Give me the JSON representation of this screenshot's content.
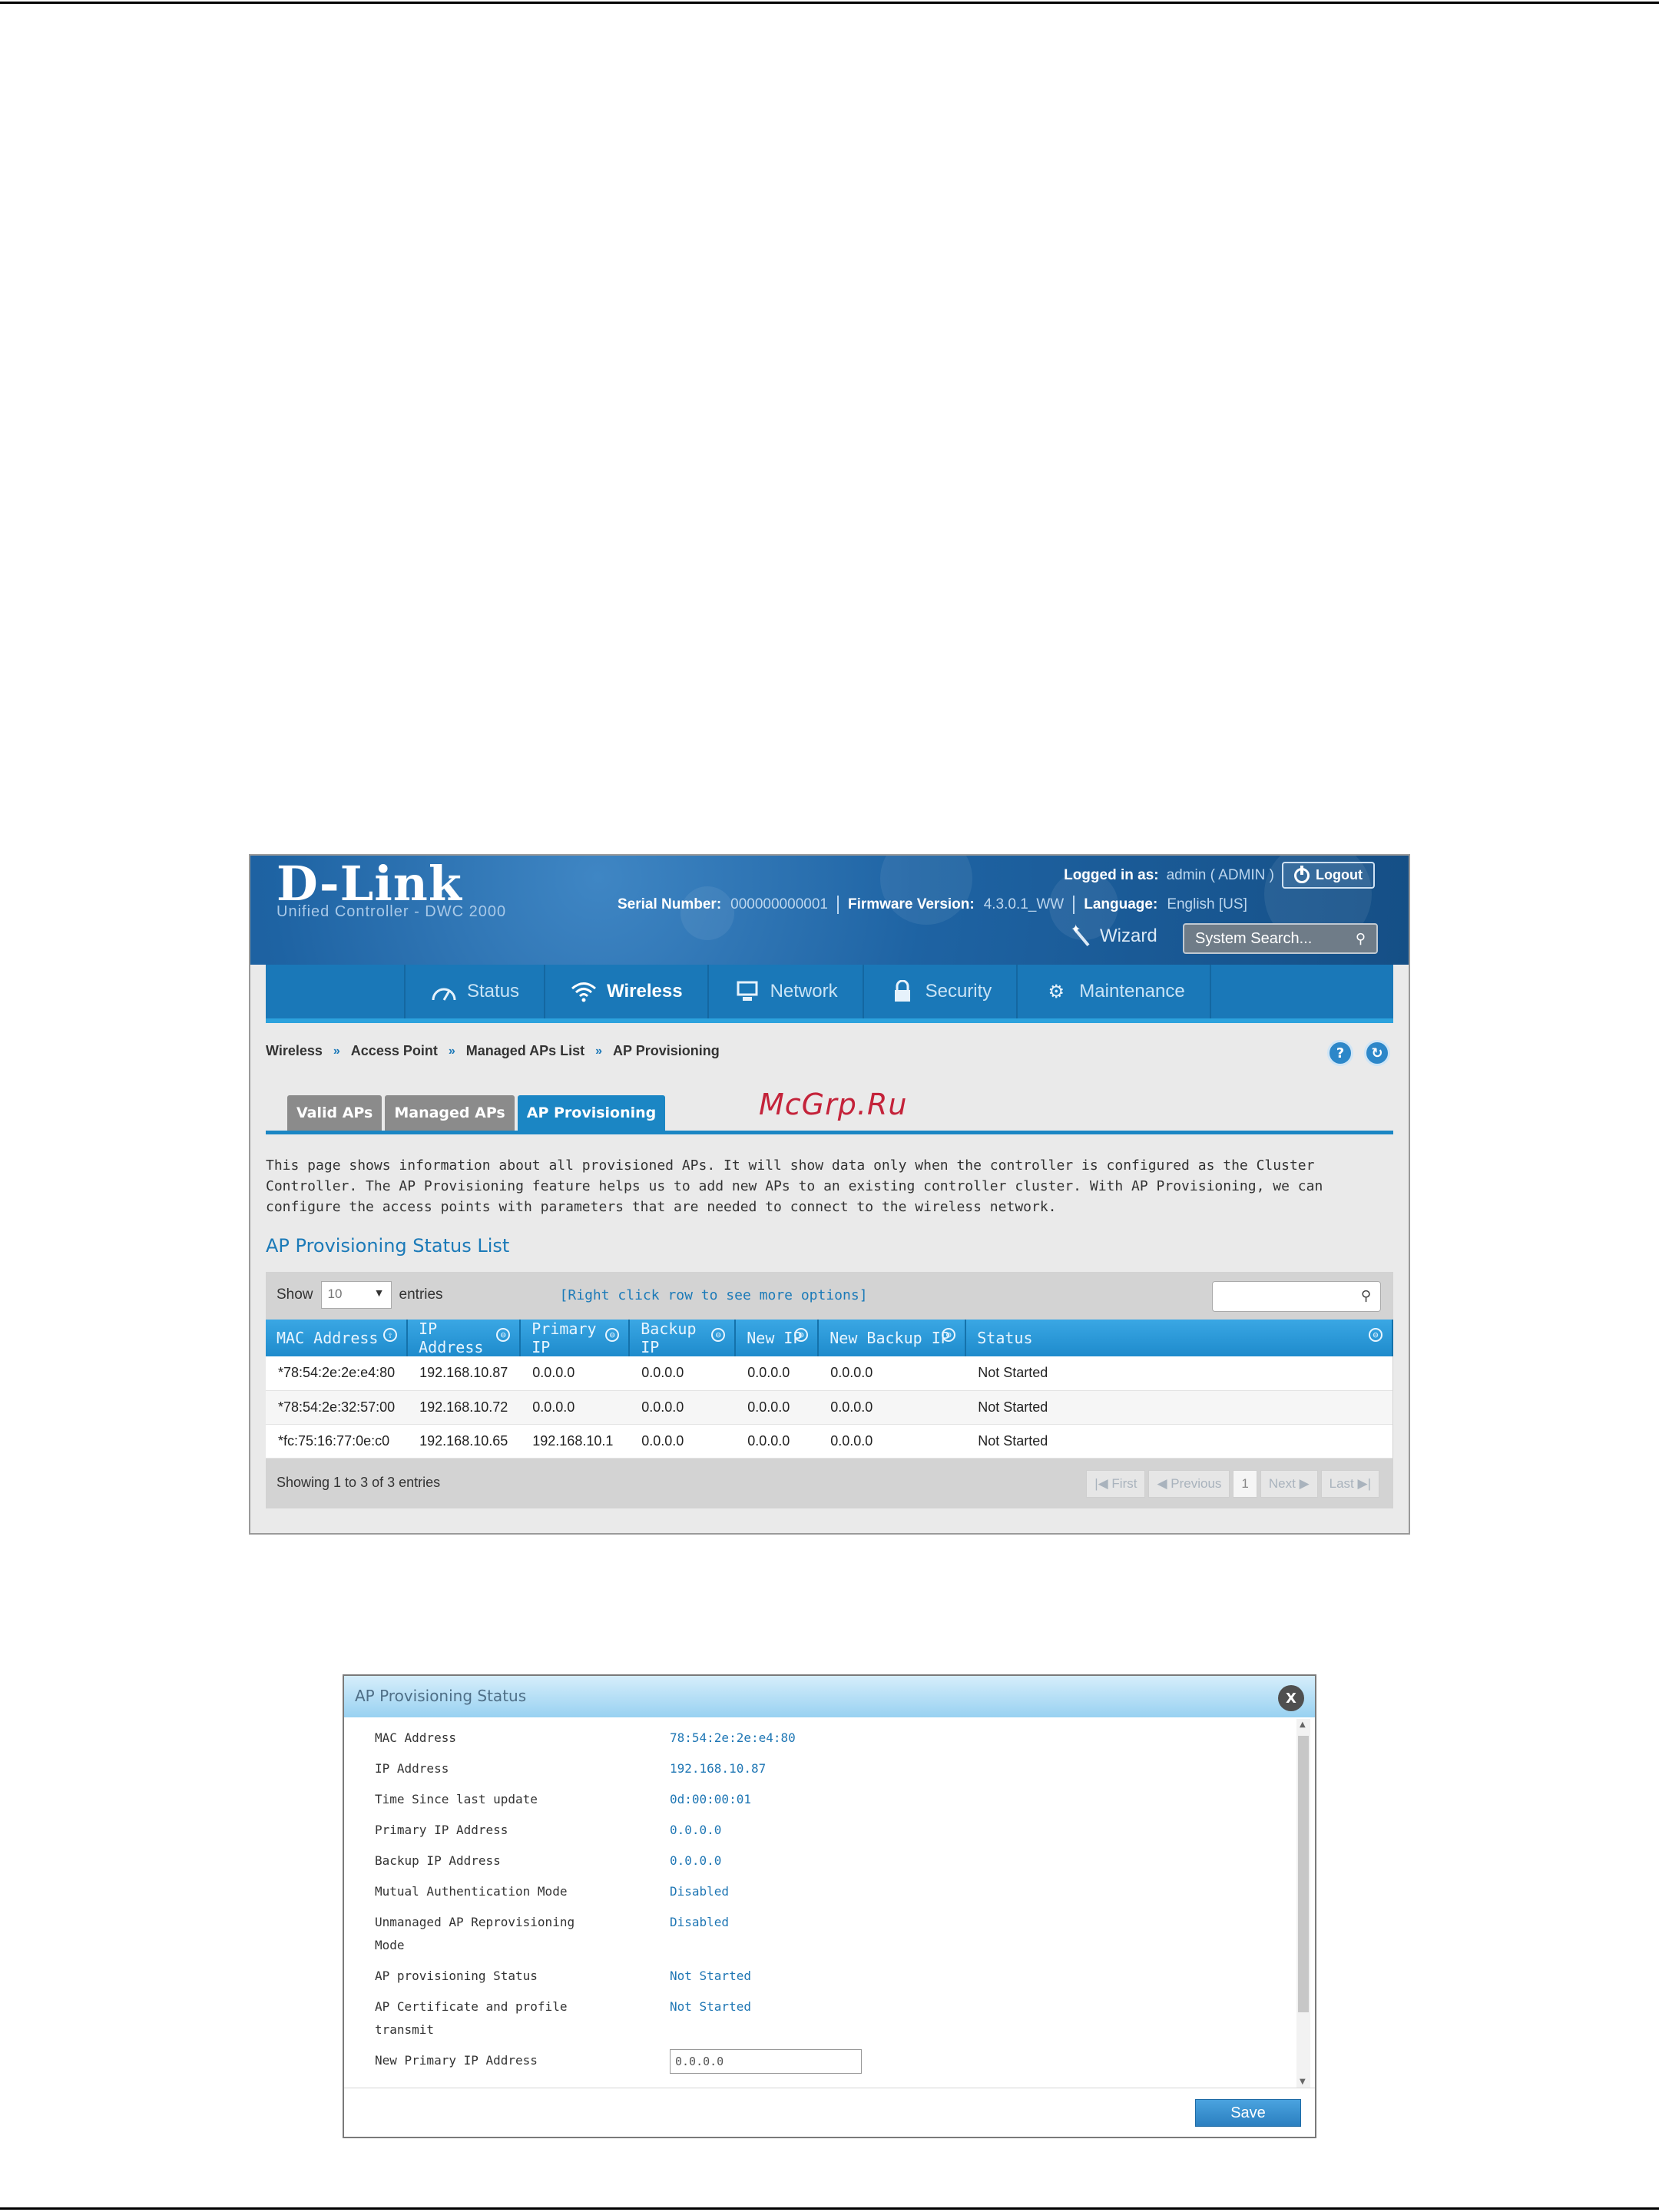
{
  "header": {
    "logo": "D-Link",
    "subtitle": "Unified Controller - DWC 2000",
    "logged_in_label": "Logged in as:",
    "logged_in_value": "admin ( ADMIN )",
    "logout_label": "Logout",
    "serial_label": "Serial Number:",
    "serial_value": "000000000001",
    "firmware_label": "Firmware Version:",
    "firmware_value": "4.3.0.1_WW",
    "language_label": "Language:",
    "language_value": "English [US]",
    "wizard_label": "Wizard",
    "search_placeholder": "System Search..."
  },
  "nav": {
    "items": [
      {
        "label": "Status",
        "icon": "gauge-icon"
      },
      {
        "label": "Wireless",
        "icon": "wifi-icon"
      },
      {
        "label": "Network",
        "icon": "network-icon"
      },
      {
        "label": "Security",
        "icon": "lock-icon"
      },
      {
        "label": "Maintenance",
        "icon": "gears-icon"
      }
    ],
    "active": "Wireless"
  },
  "breadcrumb": [
    "Wireless",
    "Access Point",
    "Managed APs List",
    "AP Provisioning"
  ],
  "tabs": [
    "Valid APs",
    "Managed APs",
    "AP Provisioning"
  ],
  "watermark": "McGrp.Ru",
  "description": "This page shows information about all provisioned APs. It will show data only when the controller is configured as the Cluster Controller. The AP Provisioning feature helps us to add new APs to an existing controller cluster. With AP Provisioning, we can configure the access points with parameters that are needed to connect to the wireless network.",
  "section_title": "AP Provisioning Status List",
  "table": {
    "show_label": "Show",
    "show_value": "10",
    "entries_label": "entries",
    "right_click_hint": "[Right click row to see more options]",
    "columns": [
      "MAC Address",
      "IP Address",
      "Primary IP",
      "Backup IP",
      "New IP",
      "New Backup IP",
      "Status"
    ],
    "rows": [
      [
        "*78:54:2e:2e:e4:80",
        "192.168.10.87",
        "0.0.0.0",
        "0.0.0.0",
        "0.0.0.0",
        "0.0.0.0",
        "Not Started"
      ],
      [
        "*78:54:2e:32:57:00",
        "192.168.10.72",
        "0.0.0.0",
        "0.0.0.0",
        "0.0.0.0",
        "0.0.0.0",
        "Not Started"
      ],
      [
        "*fc:75:16:77:0e:c0",
        "192.168.10.65",
        "192.168.10.1",
        "0.0.0.0",
        "0.0.0.0",
        "0.0.0.0",
        "Not Started"
      ]
    ],
    "footer": "Showing 1 to 3 of 3 entries",
    "pager": {
      "first": "First",
      "previous": "Previous",
      "page": "1",
      "next": "Next",
      "last": "Last"
    }
  },
  "dialog": {
    "title": "AP Provisioning Status",
    "close": "X",
    "fields": [
      {
        "label": "MAC Address",
        "value": "78:54:2e:2e:e4:80"
      },
      {
        "label": "IP Address",
        "value": "192.168.10.87"
      },
      {
        "label": "Time Since last update",
        "value": "0d:00:00:01"
      },
      {
        "label": "Primary IP Address",
        "value": "0.0.0.0"
      },
      {
        "label": "Backup IP Address",
        "value": "0.0.0.0"
      },
      {
        "label": "Mutual Authentication Mode",
        "value": "Disabled"
      },
      {
        "label": "Unmanaged AP Reprovisioning Mode",
        "value": "Disabled"
      },
      {
        "label": "AP provisioning Status",
        "value": "Not Started"
      },
      {
        "label": "AP Certificate and profile transmit",
        "value": "Not Started"
      }
    ],
    "new_primary_label": "New Primary IP Address",
    "new_primary_value": "0.0.0.0",
    "save_label": "Save"
  }
}
